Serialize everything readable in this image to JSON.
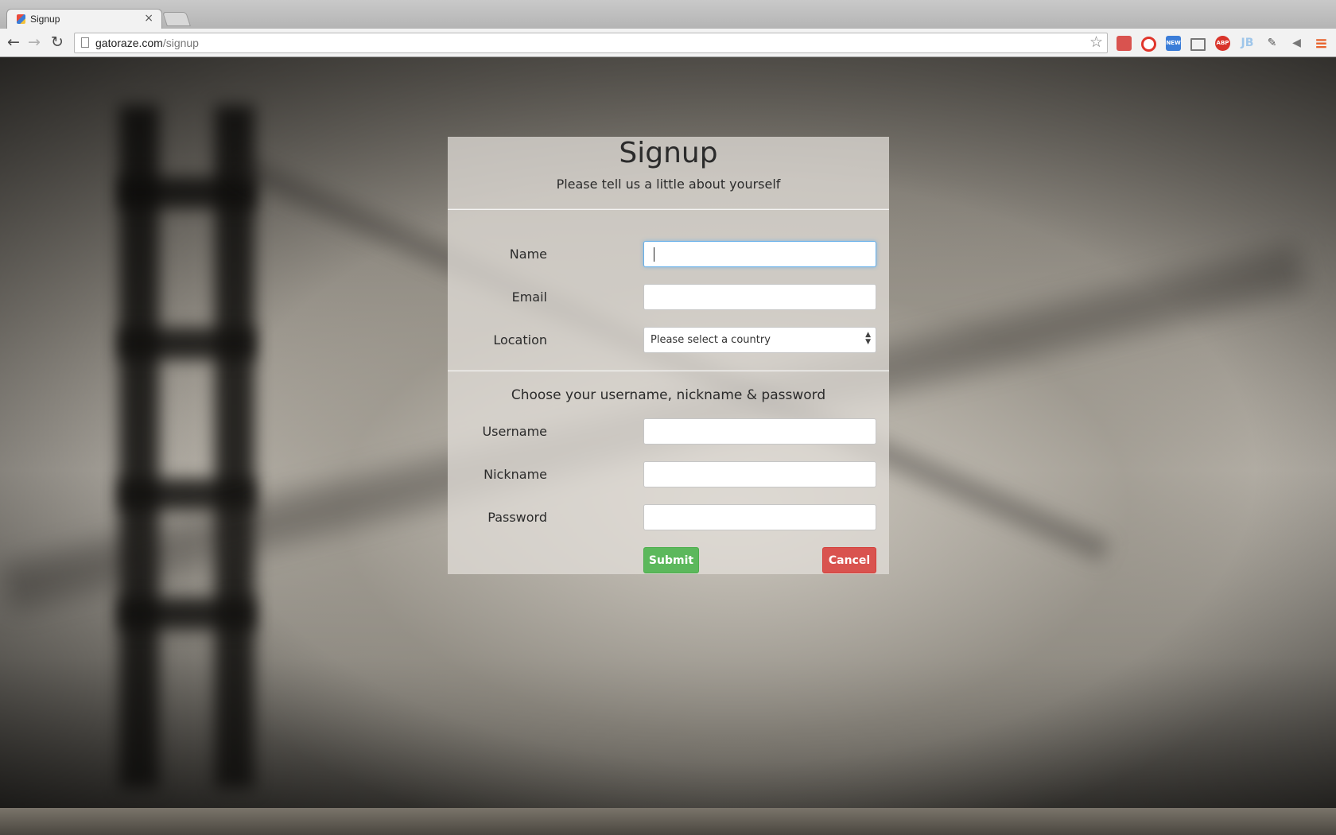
{
  "browser": {
    "tab_title": "Signup",
    "tab_close": "×",
    "url_host": "gatoraze.com",
    "url_path": "/signup",
    "nav": {
      "back": "←",
      "forward": "→",
      "reload": "↻"
    },
    "star": "☆",
    "extensions": [
      {
        "name": "bookmark-extension-icon",
        "label": "",
        "color": "#d9534f"
      },
      {
        "name": "record-extension-icon",
        "label": "",
        "color": "#e0352b"
      },
      {
        "name": "new-extension-icon",
        "label": "NEW",
        "color": "#3b7dd8"
      },
      {
        "name": "cast-icon",
        "label": "",
        "color": "#777777"
      },
      {
        "name": "adblock-icon",
        "label": "ABP",
        "color": "#d9342b"
      },
      {
        "name": "jb-extension-icon",
        "label": "JB",
        "color": "#9fc6ea"
      },
      {
        "name": "eyedropper-extension-icon",
        "label": "",
        "color": "#555555"
      },
      {
        "name": "speaker-extension-icon",
        "label": "",
        "color": "#777777"
      },
      {
        "name": "chrome-menu-icon",
        "label": "≡",
        "color": "#e8622c"
      }
    ]
  },
  "form": {
    "title": "Signup",
    "subtitle": "Please tell us a little about yourself",
    "labels": {
      "name": "Name",
      "email": "Email",
      "location": "Location",
      "username": "Username",
      "nickname": "Nickname",
      "password": "Password"
    },
    "values": {
      "name": "",
      "email": "",
      "username": "",
      "nickname": "",
      "password": ""
    },
    "location_selected": "Please select a country",
    "section_title": "Choose your username, nickname & password",
    "submit_label": "Submit",
    "cancel_label": "Cancel"
  },
  "colors": {
    "submit": "#5cb85c",
    "cancel": "#d9534f",
    "focus": "#66afe9"
  }
}
